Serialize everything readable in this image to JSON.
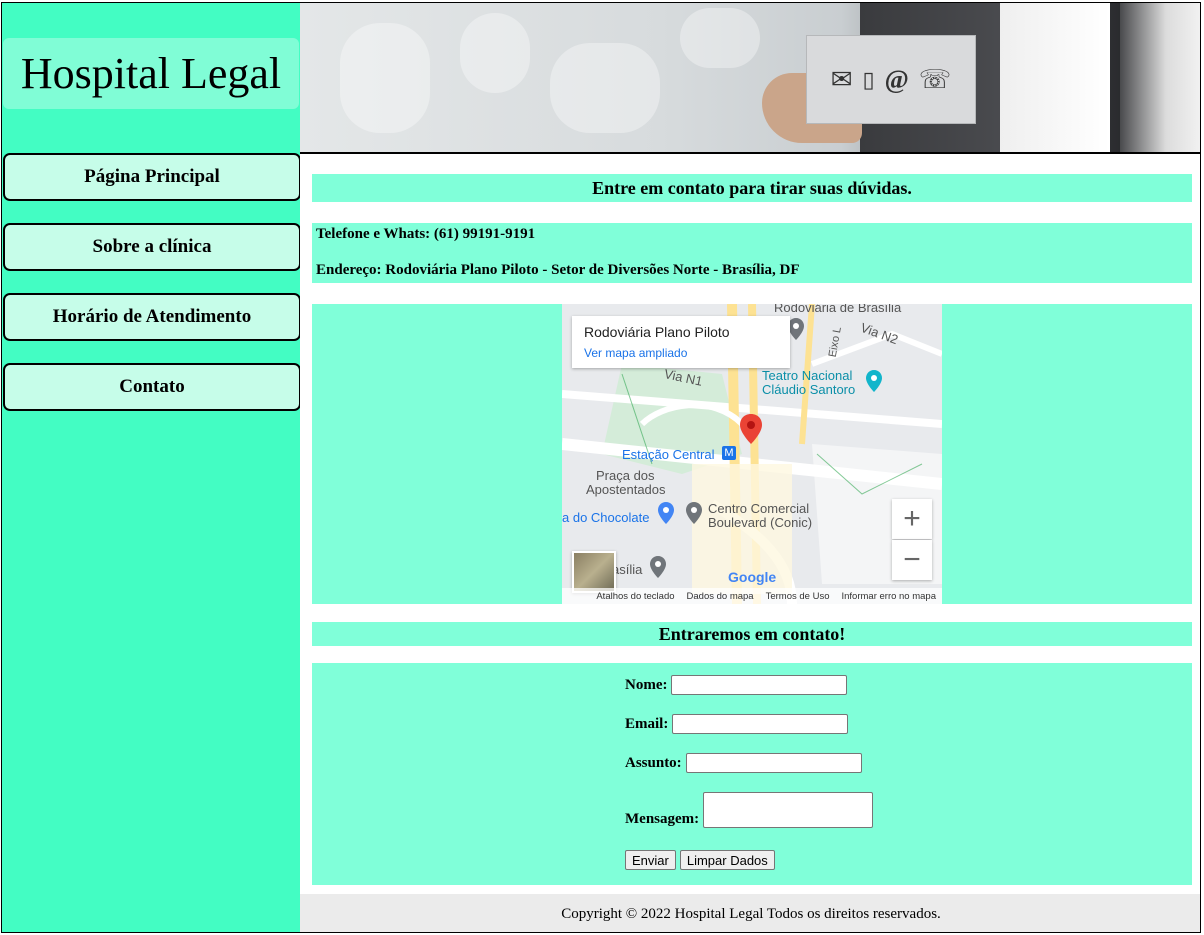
{
  "brand": {
    "name": "Hospital Legal"
  },
  "nav": {
    "items": [
      {
        "label": "Página Principal"
      },
      {
        "label": "Sobre a clínica"
      },
      {
        "label": "Horário de Atendimento"
      },
      {
        "label": "Contato"
      }
    ]
  },
  "header": {
    "contact_icons": [
      "envelope-icon",
      "mobile-phone-icon",
      "at-sign-icon",
      "telephone-icon"
    ]
  },
  "contact": {
    "heading": "Entre em contato para tirar suas dúvidas.",
    "phone_line": "Telefone e Whats: (61) 99191-9191",
    "address_line": "Endereço: Rodoviária Plano Piloto - Setor de Diversões Norte - Brasília, DF"
  },
  "map": {
    "place_name": "Rodoviária Plano Piloto",
    "view_larger": "Ver mapa ampliado",
    "labels": {
      "rodoviaria": "Rodoviária de Brasília",
      "via_n2": "Via N2",
      "eixo_l": "Eixo L",
      "via_n1": "Via N1",
      "teatro1": "Teatro Nacional",
      "teatro2": "Cláudio Santoro",
      "estacao": "Estação Central",
      "praca1": "Praça dos",
      "praca2": "Apostentados",
      "chocolate": "a do Chocolate",
      "conic1": "Centro Comercial",
      "conic2": "Boulevard (Conic)",
      "brasilia": "asília",
      "google": "Google"
    },
    "zoom_in": "+",
    "zoom_out": "−",
    "footer": {
      "shortcuts": "Atalhos do teclado",
      "map_data": "Dados do mapa",
      "terms": "Termos de Uso",
      "report": "Informar erro no mapa"
    }
  },
  "form": {
    "heading": "Entraremos em contato!",
    "name_label": "Nome:",
    "email_label": "Email:",
    "subject_label": "Assunto:",
    "message_label": "Mensagem:",
    "name_value": "",
    "email_value": "",
    "subject_value": "",
    "message_value": "",
    "submit_label": "Enviar",
    "reset_label": "Limpar Dados"
  },
  "footer": {
    "text": "Copyright © 2022 Hospital Legal Todos os direitos reservados."
  },
  "colors": {
    "sidebar": "#43fdc3",
    "band": "#80ffd9",
    "nav_button": "#c6fde9",
    "footer": "#ebebeb"
  }
}
